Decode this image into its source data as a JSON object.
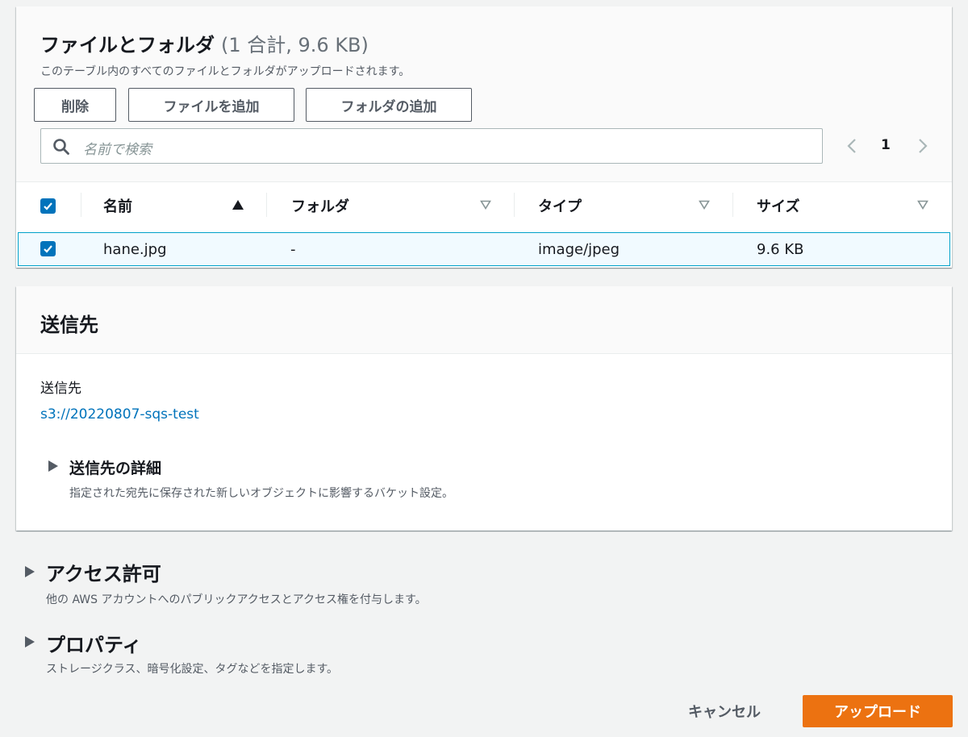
{
  "files_panel": {
    "title": "ファイルとフォルダ",
    "count": "(1 合計, 9.6 KB)",
    "description": "このテーブル内のすべてのファイルとフォルダがアップロードされます。",
    "buttons": {
      "delete": "削除",
      "add_files": "ファイルを追加",
      "add_folder": "フォルダの追加"
    },
    "search": {
      "placeholder": "名前で検索"
    },
    "pagination": {
      "page": "1"
    },
    "table": {
      "columns": [
        "名前",
        "フォルダ",
        "タイプ",
        "サイズ"
      ],
      "rows": [
        {
          "name": "hane.jpg",
          "folder": "-",
          "type": "image/jpeg",
          "size": "9.6 KB",
          "selected": true
        }
      ]
    }
  },
  "destination_panel": {
    "title": "送信先",
    "label": "送信先",
    "link": "s3://20220807-sqs-test",
    "details": {
      "title": "送信先の詳細",
      "description": "指定された宛先に保存された新しいオブジェクトに影響するバケット設定。"
    }
  },
  "access_section": {
    "title": "アクセス許可",
    "description": "他の AWS アカウントへのパブリックアクセスとアクセス権を付与します。"
  },
  "properties_section": {
    "title": "プロパティ",
    "description": "ストレージクラス、暗号化設定、タグなどを指定します。"
  },
  "footer": {
    "cancel": "キャンセル",
    "upload": "アップロード"
  },
  "colors": {
    "accent_blue": "#0073bb",
    "upload_orange": "#ec7211",
    "selected_row_bg": "#f1faff",
    "selected_row_border": "#00a1c9"
  },
  "icons": {
    "search": "search-icon",
    "prev": "chevron-left-icon",
    "next": "chevron-right-icon",
    "sort_asc": "sort-ascending-icon",
    "sort": "sort-icon",
    "expand": "caret-right-icon",
    "check": "checkbox-checked-icon"
  }
}
